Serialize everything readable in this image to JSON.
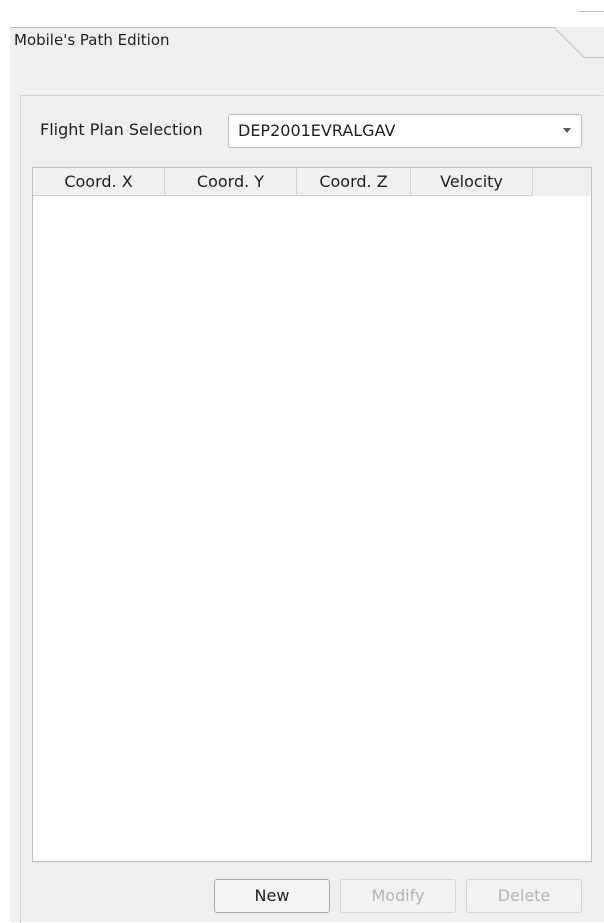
{
  "tab": {
    "title": "Mobile's Path Edition"
  },
  "flight_plan": {
    "label": "Flight Plan Selection",
    "selected": "DEP2001EVRALGAV"
  },
  "table": {
    "columns": [
      "Coord. X",
      "Coord. Y",
      "Coord. Z",
      "Velocity"
    ],
    "rows": []
  },
  "buttons": {
    "new_label": "New",
    "modify_label": "Modify",
    "delete_label": "Delete"
  },
  "icons": {
    "combo_arrow": "chevron-down-icon"
  },
  "colors": {
    "panel_bg": "#efefef",
    "content_bg": "#ffffff",
    "disabled_text": "#b4b4b4"
  }
}
